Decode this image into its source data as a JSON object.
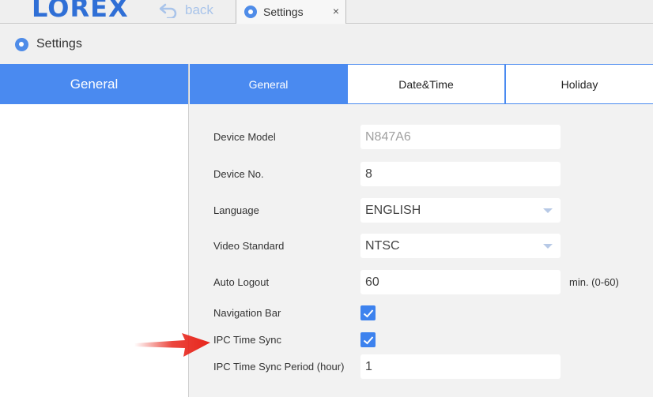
{
  "app": {
    "logo": "LOREX"
  },
  "topbar": {
    "back_label": "back",
    "tab_label": "Settings",
    "tab_close": "×"
  },
  "page": {
    "title": "Settings"
  },
  "leftnav": {
    "items": [
      {
        "label": "General",
        "active": true
      }
    ]
  },
  "subtabs": [
    {
      "label": "General",
      "active": true
    },
    {
      "label": "Date&Time",
      "active": false
    },
    {
      "label": "Holiday",
      "active": false
    }
  ],
  "form": {
    "device_model": {
      "label": "Device Model",
      "value": "N847A6"
    },
    "device_no": {
      "label": "Device No.",
      "value": "8"
    },
    "language": {
      "label": "Language",
      "value": "ENGLISH"
    },
    "video_standard": {
      "label": "Video Standard",
      "value": "NTSC"
    },
    "auto_logout": {
      "label": "Auto Logout",
      "value": "60",
      "unit": "min. (0-60)"
    },
    "navigation_bar": {
      "label": "Navigation Bar",
      "checked": true
    },
    "ipc_time_sync": {
      "label": "IPC Time Sync",
      "checked": true
    },
    "ipc_time_sync_period": {
      "label": "IPC Time Sync Period (hour)",
      "value": "1"
    }
  },
  "colors": {
    "accent": "#4a8af0",
    "logo": "#2f6fd6",
    "annotation": "#e8261c"
  }
}
